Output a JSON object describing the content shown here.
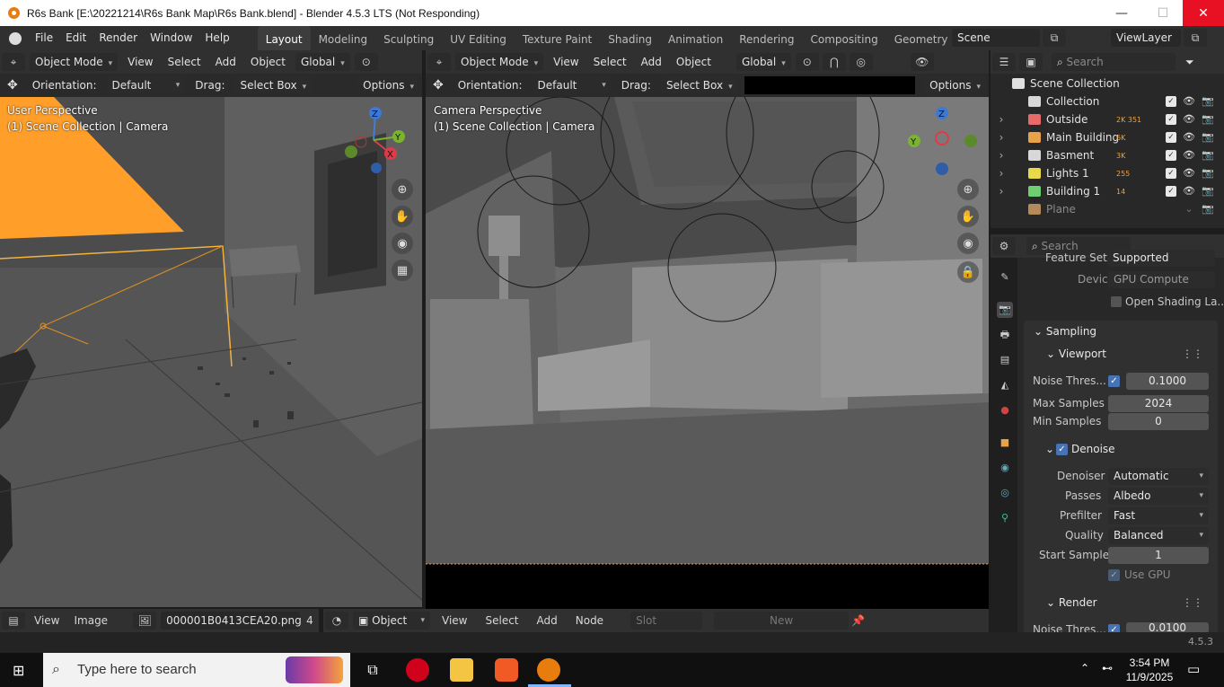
{
  "window": {
    "title": "R6s Bank [E:\\20221214\\R6s Bank Map\\R6s Bank.blend] - Blender 4.5.3 LTS (Not Responding)",
    "min": "—",
    "max": "☐",
    "close": "✕"
  },
  "topbar": {
    "menus": [
      "File",
      "Edit",
      "Render",
      "Window",
      "Help"
    ],
    "workspaces": [
      "Layout",
      "Modeling",
      "Sculpting",
      "UV Editing",
      "Texture Paint",
      "Shading",
      "Animation",
      "Rendering",
      "Compositing",
      "Geometry Node"
    ],
    "active_workspace": "Layout",
    "scene": "Scene",
    "view_layer": "ViewLayer"
  },
  "left_viewport": {
    "mode": "Object Mode",
    "menus": [
      "View",
      "Select",
      "Add",
      "Object"
    ],
    "transform": "Global",
    "orientation_label": "Orientation:",
    "orientation": "Default",
    "drag_label": "Drag:",
    "drag": "Select Box",
    "options": "Options",
    "overlay_title": "User Perspective",
    "overlay_sub": "(1) Scene Collection | Camera"
  },
  "right_viewport": {
    "mode": "Object Mode",
    "menus": [
      "View",
      "Select",
      "Add",
      "Object"
    ],
    "transform": "Global",
    "orientation_label": "Orientation:",
    "orientation": "Default",
    "drag_label": "Drag:",
    "drag": "Select Box",
    "options": "Options",
    "overlay_title": "Camera Perspective",
    "overlay_sub": "(1) Scene Collection | Camera"
  },
  "gizmo": {
    "x": "X",
    "y": "Y",
    "z": "Z"
  },
  "outliner": {
    "search_placeholder": "Search",
    "root": "Scene Collection",
    "items": [
      {
        "name": "Collection",
        "color": "#d8d8d8",
        "badge": ""
      },
      {
        "name": "Outside",
        "color": "#e86a6a",
        "badge": "2K 351"
      },
      {
        "name": "Main Building",
        "color": "#e8a24a",
        "badge": "6K"
      },
      {
        "name": "Basment",
        "color": "#d8d8d8",
        "badge": "3K"
      },
      {
        "name": "Lights 1",
        "color": "#e8d84a",
        "badge": "255"
      },
      {
        "name": "Building 1",
        "color": "#6fce6f",
        "badge": "14"
      },
      {
        "name": "Plane",
        "color": "#b58a5a",
        "badge": ""
      }
    ]
  },
  "properties": {
    "search_placeholder": "Search",
    "feature_set_label": "Feature Set",
    "feature_set": "Supported",
    "device_label": "Device",
    "device": "GPU Compute",
    "open_shading": "Open Shading La...",
    "sampling": "Sampling",
    "viewport": "Viewport",
    "noise_label": "Noise Thres...",
    "noise_value": "0.1000",
    "max_label": "Max Samples",
    "max_value": "2024",
    "min_label": "Min Samples",
    "min_value": "0",
    "denoise": "Denoise",
    "denoiser_label": "Denoiser",
    "denoiser": "Automatic",
    "passes_label": "Passes",
    "passes": "Albedo",
    "prefilter_label": "Prefilter",
    "prefilter": "Fast",
    "quality_label": "Quality",
    "quality": "Balanced",
    "start_label": "Start Sample",
    "start_value": "1",
    "use_gpu": "Use GPU",
    "render": "Render",
    "render_noise_label": "Noise Thres...",
    "render_noise_value": "0.0100"
  },
  "image_editor": {
    "menus": [
      "View",
      "Image"
    ],
    "image_name": "000001B0413CEA20.png",
    "slot_hint": "4"
  },
  "node_editor": {
    "object": "Object",
    "menus": [
      "View",
      "Select",
      "Add",
      "Node"
    ],
    "slot": "Slot",
    "new": "New"
  },
  "status": {
    "version": "4.5.3"
  },
  "taskbar": {
    "search": "Type here to search",
    "time": "3:54 PM",
    "date": "11/9/2025"
  }
}
